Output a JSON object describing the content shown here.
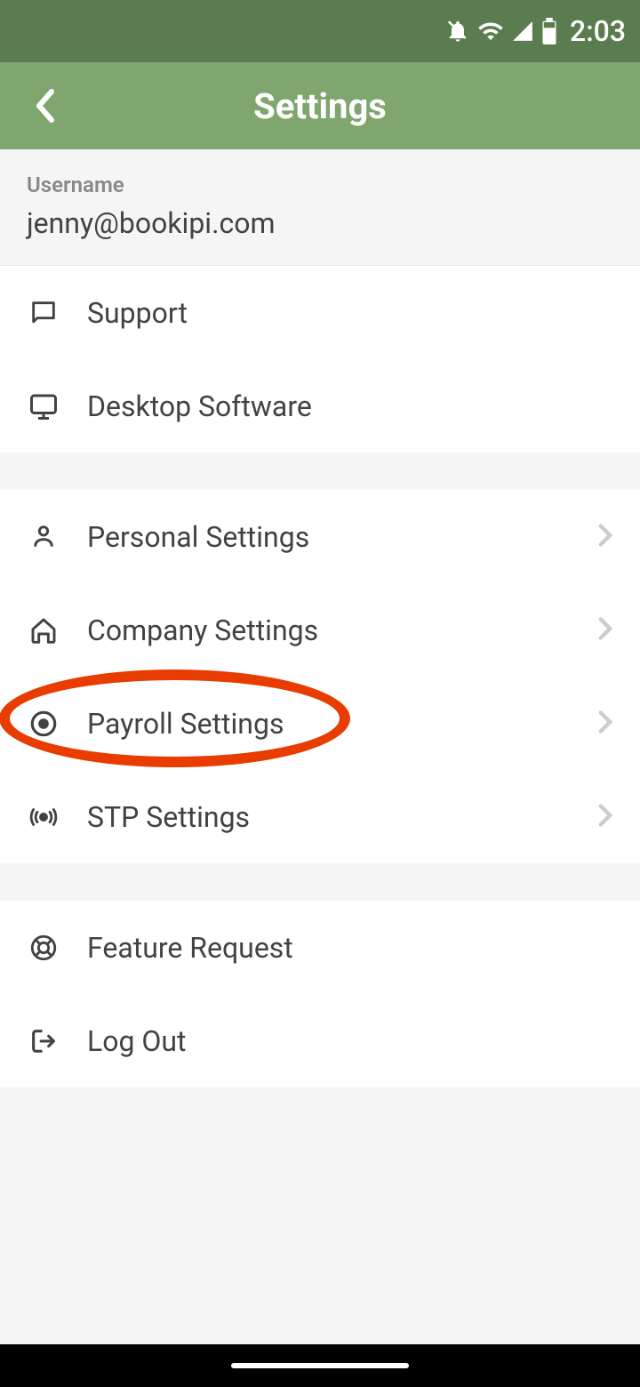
{
  "statusBar": {
    "time": "2:03"
  },
  "header": {
    "title": "Settings"
  },
  "user": {
    "label": "Username",
    "email": "jenny@bookipi.com"
  },
  "group1": {
    "support": "Support",
    "desktop": "Desktop Software"
  },
  "group2": {
    "personal": "Personal Settings",
    "company": "Company Settings",
    "payroll": "Payroll Settings",
    "stp": "STP Settings"
  },
  "group3": {
    "feature": "Feature Request",
    "logout": "Log Out"
  }
}
